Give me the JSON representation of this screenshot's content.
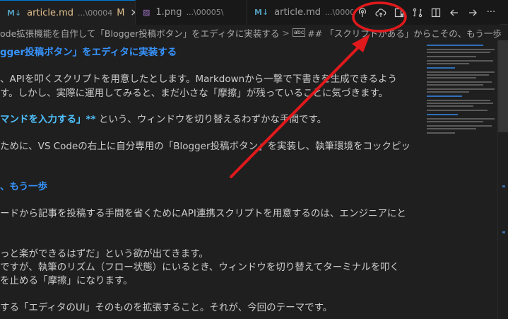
{
  "tabs": [
    {
      "icon": "M↓",
      "name": "article.md",
      "path": "...\\00004",
      "modified": "M",
      "close": "×"
    },
    {
      "icon": "▨",
      "name": "1.png",
      "path": "...\\00005\\"
    },
    {
      "icon": "M↓",
      "name": "article.md",
      "path": "...\\00005"
    }
  ],
  "breadcrumb": {
    "file": "ode拡張機能を自作して「Blogger投稿ボタン」をエディタに実装する",
    "separator": ">",
    "symbol": "abc",
    "section": "## 「スクリプトがある」からこその、もう一歩"
  },
  "editor": {
    "lines": [
      {
        "kind": "heading",
        "text": "gger投稿ボタン」をエディタに実装する"
      },
      {
        "kind": "text",
        "text": "、APIを叩くスクリプトを用意したとします。Markdownから一撃で下書きを生成できるよう"
      },
      {
        "kind": "text",
        "text": "す。しかし、実際に運用してみると、まだ小さな「摩擦」が残っていることに気づきます。"
      },
      {
        "kind": "mixed",
        "bold": "マンドを入力する」**",
        "text": " という、ウィンドウを切り替えるわずかな手間です。"
      },
      {
        "kind": "text",
        "text": "ために、VS Codeの右上に自分専用の「Blogger投稿ボタン」を実装し、執筆環境をコックピッ"
      },
      {
        "kind": "heading",
        "text": "、もう一歩"
      },
      {
        "kind": "text",
        "text": "ードから記事を投稿する手間を省くためにAPI連携スクリプトを用意するのは、エンジニアにと"
      },
      {
        "kind": "text",
        "text": "っと楽ができるはずだ」という欲が出てきます。"
      },
      {
        "kind": "text",
        "text": "ですが、執筆のリズム（フロー状態）にいるとき、ウィンドウを切り替えてターミナルを叩く"
      },
      {
        "kind": "text",
        "text": "を止める「摩擦」になります。"
      },
      {
        "kind": "text",
        "text": "する「エディタのUI」そのものを拡張すること。それが、今回のテーマです。"
      }
    ]
  },
  "toolbar": {
    "icons": [
      "broadcast-icon",
      "cloud-upload-icon",
      "open-preview-icon",
      "compare-changes-icon",
      "split-editor-icon",
      "go-back-icon",
      "go-forward-icon",
      "more-actions-icon"
    ],
    "more_label": "···"
  },
  "annotation": {
    "color": "#e0191c"
  }
}
